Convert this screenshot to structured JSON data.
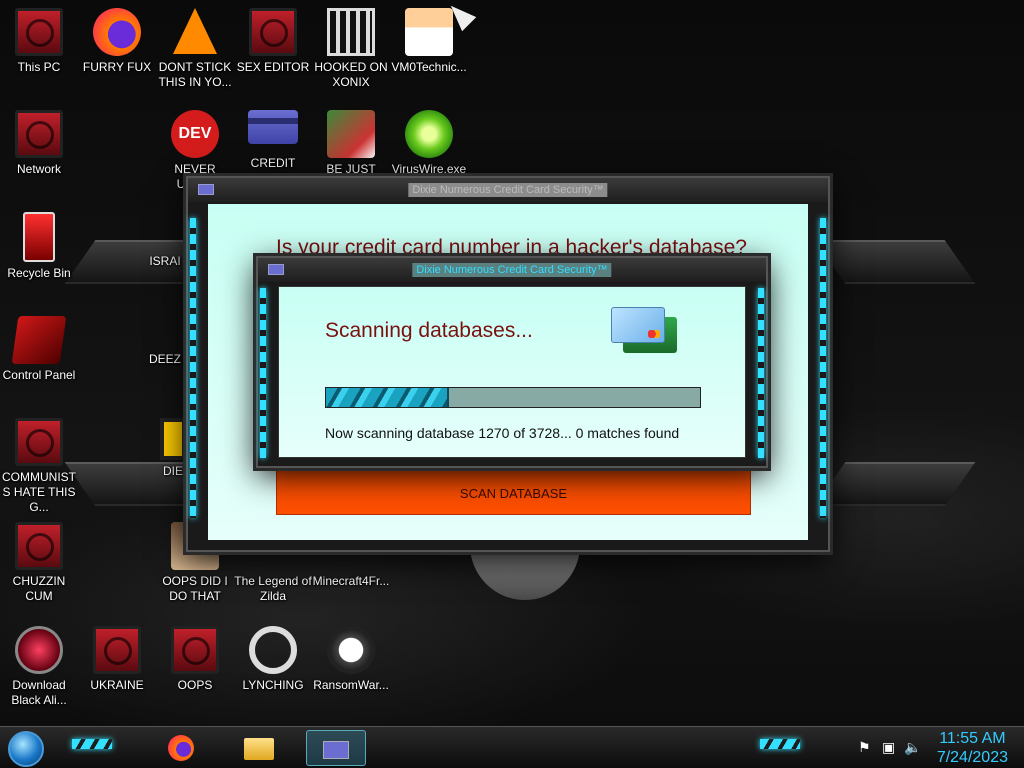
{
  "desktop": {
    "icons": [
      {
        "label": "This PC"
      },
      {
        "label": "FURRY FUX"
      },
      {
        "label": "DONT STICK THIS IN YO..."
      },
      {
        "label": "SEX EDITOR"
      },
      {
        "label": "HOOKED ON XONIX"
      },
      {
        "label": "VM0Technic..."
      },
      {
        "label": "Network"
      },
      {
        "label": "NEVER USED!"
      },
      {
        "label": "CREDIT CARD"
      },
      {
        "label": "BE JUST LIKE"
      },
      {
        "label": "VirusWire.exe"
      },
      {
        "label": "Recycle Bin"
      },
      {
        "label": "ISRAI"
      },
      {
        "label": "Control Panel"
      },
      {
        "label": "DEEZ"
      },
      {
        "label": "COMMUNISTS HATE THIS G..."
      },
      {
        "label": "DIE"
      },
      {
        "label": "CHUZZIN CUM"
      },
      {
        "label": "OOPS DID I DO THAT"
      },
      {
        "label": "The Legend of Zilda"
      },
      {
        "label": "Minecraft4Fr..."
      },
      {
        "label": "Download Black Ali..."
      },
      {
        "label": "UKRAINE"
      },
      {
        "label": "OOPS"
      },
      {
        "label": "LYNCHING"
      },
      {
        "label": "RansomWar..."
      }
    ],
    "dev_badge": "DEV"
  },
  "window_back": {
    "title": "Dixie Numerous Credit Card Security™",
    "headline": "Is your credit card number in a hacker's database?",
    "scan_button": "SCAN DATABASE"
  },
  "window_front": {
    "title": "Dixie Numerous Credit Card Security™",
    "heading": "Scanning databases...",
    "progress_fraction": 0.33,
    "status": "Now scanning database 1270 of 3728... 0 matches found"
  },
  "taskbar": {
    "time": "11:55 AM",
    "date": "7/24/2023",
    "tray": {
      "flag_icon": "flag-icon",
      "network_icon": "network-icon",
      "volume_icon": "volume-icon"
    }
  },
  "colors": {
    "accent_cyan": "#33e0ff",
    "headline_red": "#7a1010",
    "button_orange": "#ff4f00",
    "client_bg": "#c8fff4"
  }
}
